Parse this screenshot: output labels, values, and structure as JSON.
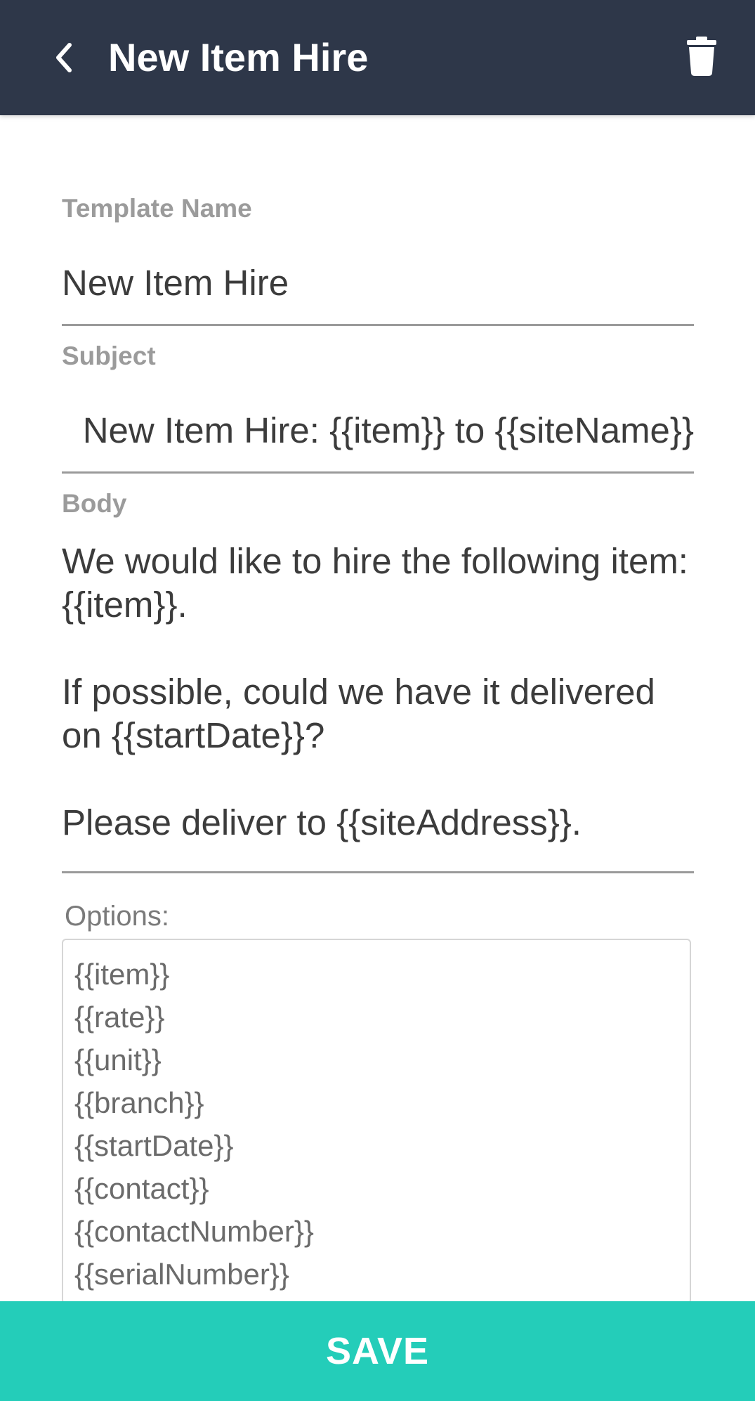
{
  "header": {
    "title": "New Item Hire",
    "back_icon": "chevron-left-icon",
    "delete_icon": "trash-icon",
    "background_color": "#2e3749"
  },
  "form": {
    "template_name": {
      "label": "Template Name",
      "value": "New Item Hire"
    },
    "subject": {
      "label": "Subject",
      "value": "New Item Hire: {{item}} to {{siteName}}"
    },
    "body": {
      "label": "Body",
      "value": "We would like to hire the following item: {{item}}.\n\nIf possible, could we have it delivered on {{startDate}}?\n\nPlease deliver to {{siteAddress}}."
    },
    "options": {
      "label": "Options:",
      "items": [
        "{{item}}",
        "{{rate}}",
        "{{unit}}",
        "{{branch}}",
        "{{startDate}}",
        "{{contact}}",
        "{{contactNumber}}",
        "{{serialNumber}}"
      ]
    }
  },
  "save_button": {
    "label": "SAVE",
    "color": "#24cdb9"
  }
}
